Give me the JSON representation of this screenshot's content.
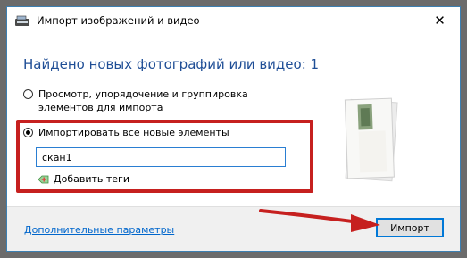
{
  "window": {
    "title": "Импорт изображений и видео",
    "close_glyph": "✕"
  },
  "heading": "Найдено новых фотографий или видео: 1",
  "options": {
    "review": {
      "line1": "Просмотр, упорядочение и группировка",
      "line2": "элементов для импорта",
      "selected": false
    },
    "import_all": {
      "label": "Импортировать все новые элементы",
      "selected": true
    }
  },
  "name_input": {
    "value": "скан1"
  },
  "add_tags_label": "Добавить теги",
  "footer": {
    "more_options_link": "Дополнительные параметры",
    "import_button": "Импорт"
  },
  "icons": {
    "app": "scanner-icon",
    "add_tags": "tag-plus-icon",
    "close": "close-icon",
    "preview": "photo-thumbnail"
  },
  "colors": {
    "heading": "#1f4e96",
    "highlight_border": "#c6201f",
    "link": "#0066cc",
    "accent": "#0078d7"
  }
}
